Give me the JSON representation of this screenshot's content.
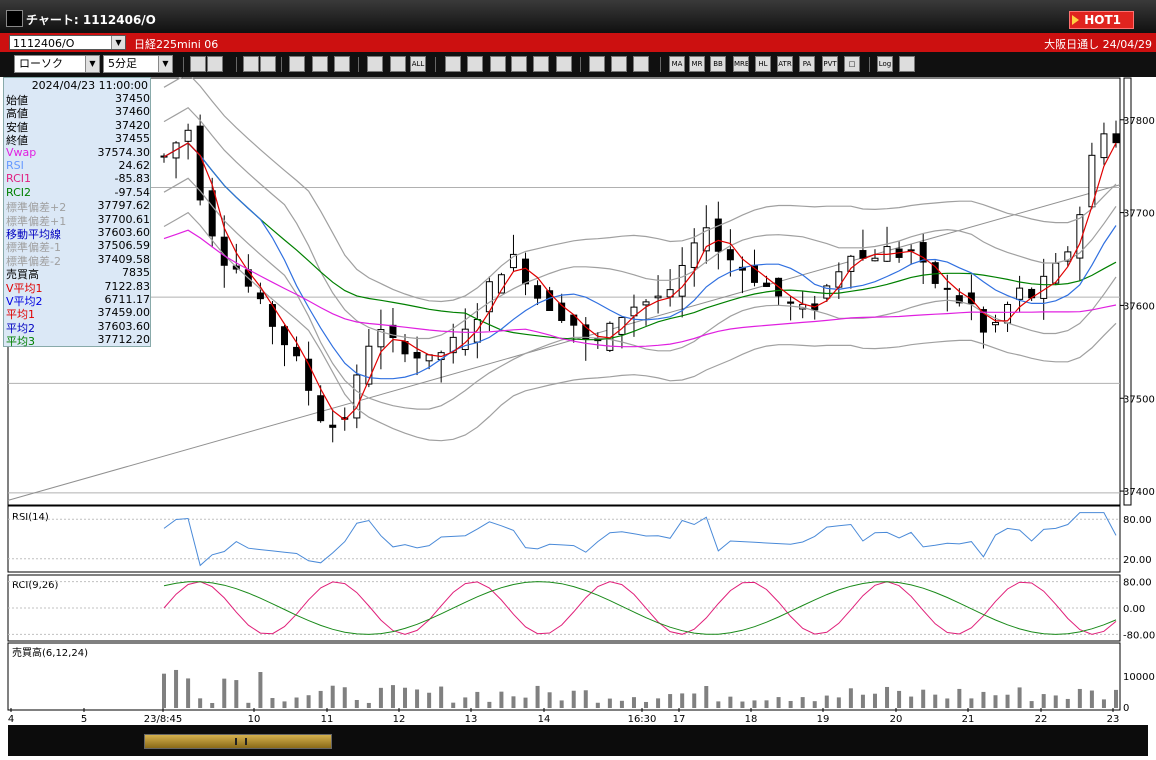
{
  "window": {
    "title": "チャート: 1112406/O",
    "hot_label": "HOT1"
  },
  "symbol_bar": {
    "symbol": "1112406/O",
    "instrument": "日経225mini 06",
    "market": "大阪日通し  24/04/29"
  },
  "toolbar": {
    "chart_type": "ローソク",
    "interval": "5分足",
    "buttons": [
      {
        "name": "zoom-icon",
        "label": ""
      },
      {
        "name": "range-icon",
        "label": ""
      },
      {
        "name": "draw-icon",
        "label": ""
      },
      {
        "name": "search-icon",
        "label": ""
      },
      {
        "name": "bars-icon",
        "label": ""
      },
      {
        "name": "signal-icon",
        "label": ""
      },
      {
        "name": "lock-icon",
        "label": ""
      },
      {
        "name": "candle-icon",
        "label": ""
      },
      {
        "name": "candle2-icon",
        "label": ""
      },
      {
        "name": "all-icon",
        "label": "ALL"
      },
      {
        "name": "pencil-icon",
        "label": ""
      },
      {
        "name": "trend-line-icon",
        "label": ""
      },
      {
        "name": "cursor-icon",
        "label": ""
      },
      {
        "name": "undo-icon",
        "label": ""
      },
      {
        "name": "note-icon",
        "label": ""
      },
      {
        "name": "trash-icon",
        "label": ""
      },
      {
        "name": "settings-icon",
        "label": ""
      },
      {
        "name": "tool-icon",
        "label": ""
      },
      {
        "name": "color-icon",
        "label": ""
      },
      {
        "name": "ma-icon",
        "label": "MA"
      },
      {
        "name": "mr-icon",
        "label": "MR"
      },
      {
        "name": "bb-icon",
        "label": "BB"
      },
      {
        "name": "mre-icon",
        "label": "MRE"
      },
      {
        "name": "hl-icon",
        "label": "HL"
      },
      {
        "name": "atr-icon",
        "label": "ATR"
      },
      {
        "name": "para-icon",
        "label": "PA"
      },
      {
        "name": "pvt-icon",
        "label": "PVT"
      },
      {
        "name": "box-icon",
        "label": "□"
      },
      {
        "name": "log-icon",
        "label": "Log"
      },
      {
        "name": "export-icon",
        "label": ""
      }
    ]
  },
  "info_panel": {
    "timestamp": "2024/04/23 11:00:00",
    "rows": [
      {
        "label": "始値",
        "value": "37450",
        "color": "#000000"
      },
      {
        "label": "高値",
        "value": "37460",
        "color": "#000000"
      },
      {
        "label": "安値",
        "value": "37420",
        "color": "#000000"
      },
      {
        "label": "終値",
        "value": "37455",
        "color": "#000000"
      },
      {
        "label": "Vwap",
        "value": "37574.30",
        "color": "#e020e0"
      },
      {
        "label": "RSI",
        "value": "24.62",
        "color": "#6699ff"
      },
      {
        "label": "RCI1",
        "value": "-85.83",
        "color": "#e02080"
      },
      {
        "label": "RCI2",
        "value": "-97.54",
        "color": "#008000"
      },
      {
        "label": "標準偏差+2",
        "value": "37797.62",
        "color": "#a0a0a0"
      },
      {
        "label": "標準偏差+1",
        "value": "37700.61",
        "color": "#a0a0a0"
      },
      {
        "label": "移動平均線",
        "value": "37603.60",
        "color": "#0000c0"
      },
      {
        "label": "標準偏差-1",
        "value": "37506.59",
        "color": "#a0a0a0"
      },
      {
        "label": "標準偏差-2",
        "value": "37409.58",
        "color": "#a0a0a0"
      },
      {
        "label": "売買高",
        "value": "7835",
        "color": "#000000"
      },
      {
        "label": "V平均1",
        "value": "7122.83",
        "color": "#e00000"
      },
      {
        "label": "V平均2",
        "value": "6711.17",
        "color": "#0000e0"
      },
      {
        "label": "平均1",
        "value": "37459.00",
        "color": "#e00000"
      },
      {
        "label": "平均2",
        "value": "37603.60",
        "color": "#0000c0"
      },
      {
        "label": "平均3",
        "value": "37712.20",
        "color": "#008000"
      }
    ]
  },
  "price_axis": {
    "ticks": [
      "37800",
      "37700",
      "37600",
      "37500",
      "37400"
    ]
  },
  "rsi_panel": {
    "label": "RSI(14)",
    "ticks": [
      "80.00",
      "20.00"
    ]
  },
  "rci_panel": {
    "label": "RCI(9,26)",
    "ticks": [
      "80.00",
      "0.00",
      "-80.00"
    ]
  },
  "volume_panel": {
    "label": "売買高(6,12,24)",
    "ticks": [
      "10000",
      "0"
    ]
  },
  "time_axis": {
    "labels": [
      "4",
      "5",
      "23/8:45",
      "10",
      "11",
      "12",
      "13",
      "14",
      "16:30",
      "17",
      "18",
      "19",
      "20",
      "21",
      "22",
      "23"
    ]
  },
  "colors": {
    "price_ma_short": "#e00000",
    "price_ma_mid": "#3070e0",
    "price_ma_long": "#008000",
    "vwap": "#e020e0",
    "bands": "#a0a0a0",
    "rsi": "#4a8ad8",
    "rci1": "#e0207a",
    "rci2": "#1a8a1a"
  },
  "chart_data": {
    "type": "candlestick",
    "price_range": [
      37385,
      37845
    ],
    "close_path": [
      37760,
      37775,
      37790,
      37720,
      37680,
      37650,
      37640,
      37620,
      37600,
      37580,
      37560,
      37540,
      37510,
      37480,
      37470,
      37480,
      37520,
      37560,
      37570,
      37560,
      37555,
      37545,
      37540,
      37550,
      37560,
      37570,
      37590,
      37620,
      37640,
      37650,
      37630,
      37610,
      37600,
      37590,
      37580,
      37560,
      37560,
      37575,
      37590,
      37600,
      37605,
      37610,
      37610,
      37640,
      37660,
      37690,
      37660,
      37650,
      37640,
      37630,
      37620,
      37610,
      37600,
      37595,
      37600,
      37620,
      37640,
      37660,
      37650,
      37655,
      37660,
      37655,
      37660,
      37640,
      37625,
      37615,
      37605,
      37600,
      37570,
      37580,
      37600,
      37615,
      37610,
      37625,
      37640,
      37660,
      37700,
      37760,
      37790,
      37775
    ]
  }
}
